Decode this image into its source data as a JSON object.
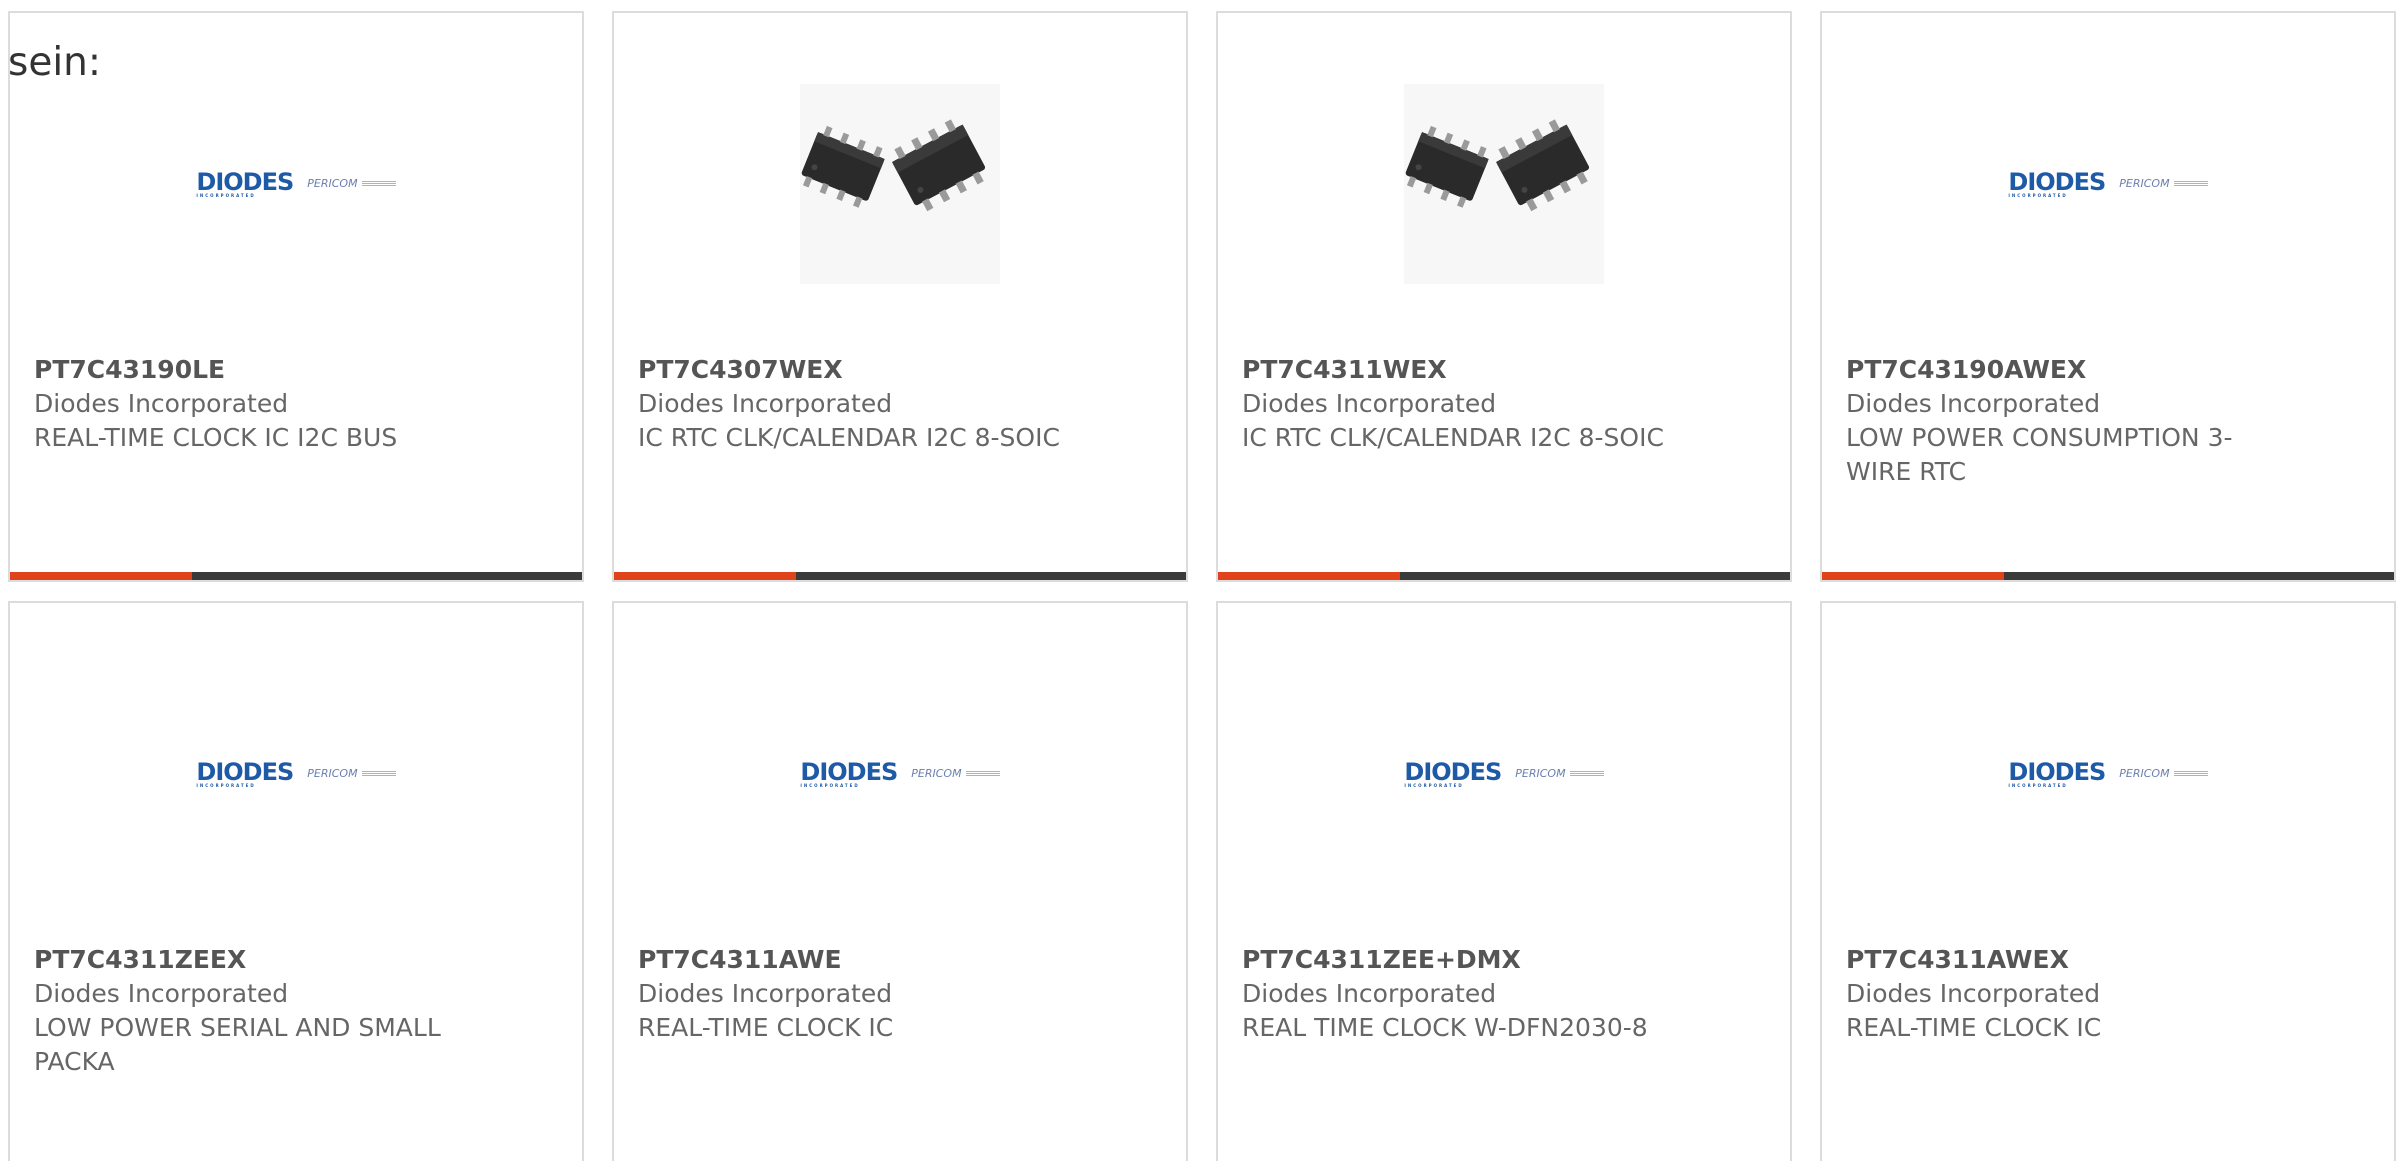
{
  "intro_text": "sein:",
  "logo": {
    "brand": "DIODES",
    "brand_sub": "INCORPORATED",
    "partner": "PERICOM"
  },
  "colors": {
    "accent": "#e0431b",
    "bar_dark": "#3b3b3b",
    "text": "#666666",
    "brand_blue": "#1f5aa6"
  },
  "products": [
    {
      "part": "PT7C43190LE",
      "manufacturer": "Diodes Incorporated",
      "description": "REAL-TIME CLOCK IC I2C BUS",
      "image": "diodes-logo"
    },
    {
      "part": "PT7C4307WEX",
      "manufacturer": "Diodes Incorporated",
      "description": "IC RTC CLK/CALENDAR I2C 8-SOIC",
      "image": "soic-chip-photo"
    },
    {
      "part": "PT7C4311WEX",
      "manufacturer": "Diodes Incorporated",
      "description": "IC RTC CLK/CALENDAR I2C 8-SOIC",
      "image": "soic-chip-photo"
    },
    {
      "part": "PT7C43190AWEX",
      "manufacturer": "Diodes Incorporated",
      "description": "LOW POWER CONSUMPTION 3-WIRE RTC",
      "image": "diodes-logo"
    },
    {
      "part": "PT7C4311ZEEX",
      "manufacturer": "Diodes Incorporated",
      "description": "LOW POWER SERIAL AND SMALL PACKA",
      "image": "diodes-logo"
    },
    {
      "part": "PT7C4311AWE",
      "manufacturer": "Diodes Incorporated",
      "description": "REAL-TIME CLOCK IC",
      "image": "diodes-logo"
    },
    {
      "part": "PT7C4311ZEE+DMX",
      "manufacturer": "Diodes Incorporated",
      "description": "REAL TIME CLOCK W-DFN2030-8",
      "image": "diodes-logo"
    },
    {
      "part": "PT7C4311AWEX",
      "manufacturer": "Diodes Incorporated",
      "description": "REAL-TIME CLOCK IC",
      "image": "diodes-logo"
    }
  ]
}
